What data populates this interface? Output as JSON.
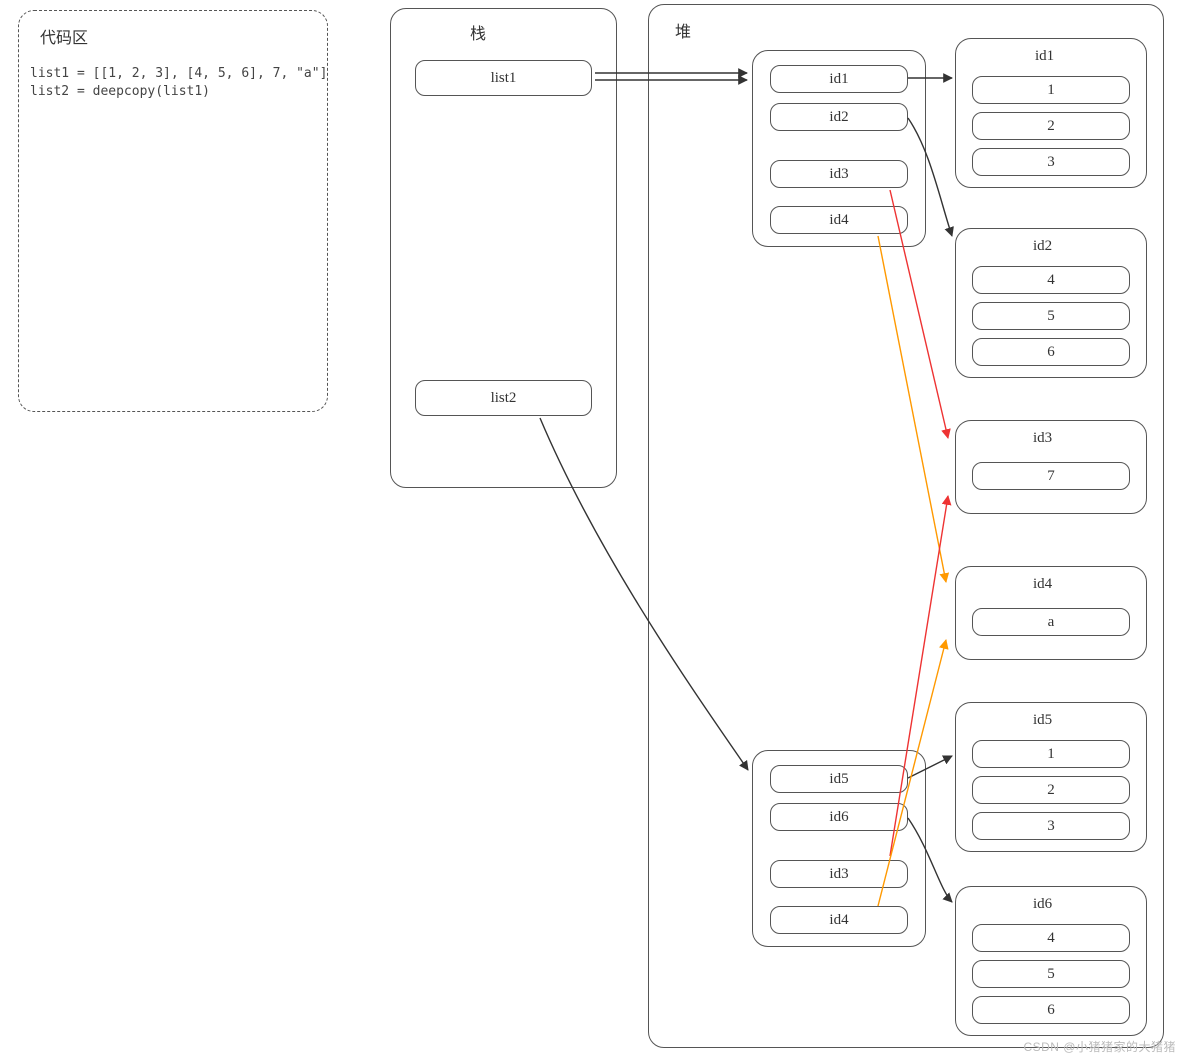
{
  "code_area": {
    "title": "代码区",
    "line1": "list1 = [[1, 2, 3], [4, 5, 6], 7, \"a\"]",
    "line2": "list2 = deepcopy(list1)"
  },
  "stack": {
    "title": "栈",
    "list1": "list1",
    "list2": "list2"
  },
  "heap": {
    "title": "堆",
    "topList": {
      "r0": "id1",
      "r1": "id2",
      "r2": "id3",
      "r3": "id4"
    },
    "botList": {
      "r0": "id5",
      "r1": "id6",
      "r2": "id3",
      "r3": "id4"
    },
    "obj_id1": {
      "title": "id1",
      "v0": "1",
      "v1": "2",
      "v2": "3"
    },
    "obj_id2": {
      "title": "id2",
      "v0": "4",
      "v1": "5",
      "v2": "6"
    },
    "obj_id3": {
      "title": "id3",
      "v0": "7"
    },
    "obj_id4": {
      "title": "id4",
      "v0": "a"
    },
    "obj_id5": {
      "title": "id5",
      "v0": "1",
      "v1": "2",
      "v2": "3"
    },
    "obj_id6": {
      "title": "id6",
      "v0": "4",
      "v1": "5",
      "v2": "6"
    }
  },
  "watermark": "CSDN @小猪猪家的大猪猪"
}
